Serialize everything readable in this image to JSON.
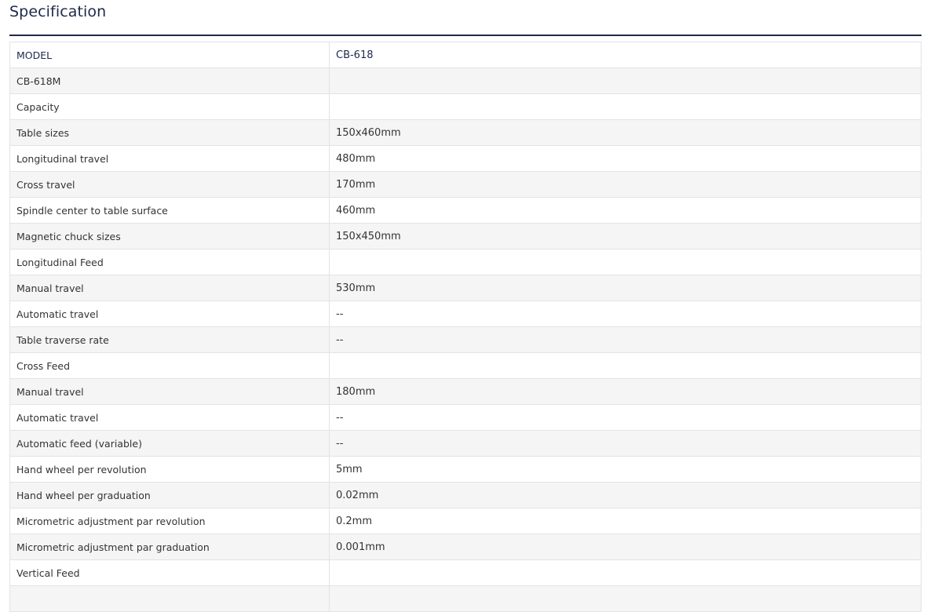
{
  "page": {
    "title": "Specification",
    "accent_color": "#1e2a4a"
  },
  "table": {
    "rows": [
      {
        "label": "MODEL",
        "value": "CB-618"
      },
      {
        "label": "CB-618M",
        "value": ""
      },
      {
        "label": "Capacity",
        "value": ""
      },
      {
        "label": "Table sizes",
        "value": "150x460mm"
      },
      {
        "label": "Longitudinal travel",
        "value": "480mm"
      },
      {
        "label": "Cross travel",
        "value": "170mm"
      },
      {
        "label": "Spindle center to table surface",
        "value": "460mm"
      },
      {
        "label": "Magnetic chuck sizes",
        "value": "150x450mm"
      },
      {
        "label": "Longitudinal Feed",
        "value": ""
      },
      {
        "label": "Manual travel",
        "value": "530mm"
      },
      {
        "label": "Automatic travel",
        "value": "--"
      },
      {
        "label": "Table traverse rate",
        "value": "--"
      },
      {
        "label": "Cross Feed",
        "value": ""
      },
      {
        "label": "Manual travel",
        "value": "180mm"
      },
      {
        "label": "Automatic travel",
        "value": "--"
      },
      {
        "label": "Automatic feed (variable)",
        "value": "--"
      },
      {
        "label": "Hand wheel per revolution",
        "value": "5mm"
      },
      {
        "label": "Hand wheel per graduation",
        "value": "0.02mm"
      },
      {
        "label": "Micrometric adjustment par revolution",
        "value": "0.2mm"
      },
      {
        "label": "Micrometric adjustment par graduation",
        "value": "0.001mm"
      },
      {
        "label": "Vertical Feed",
        "value": ""
      },
      {
        "label": "",
        "value": ""
      }
    ]
  }
}
